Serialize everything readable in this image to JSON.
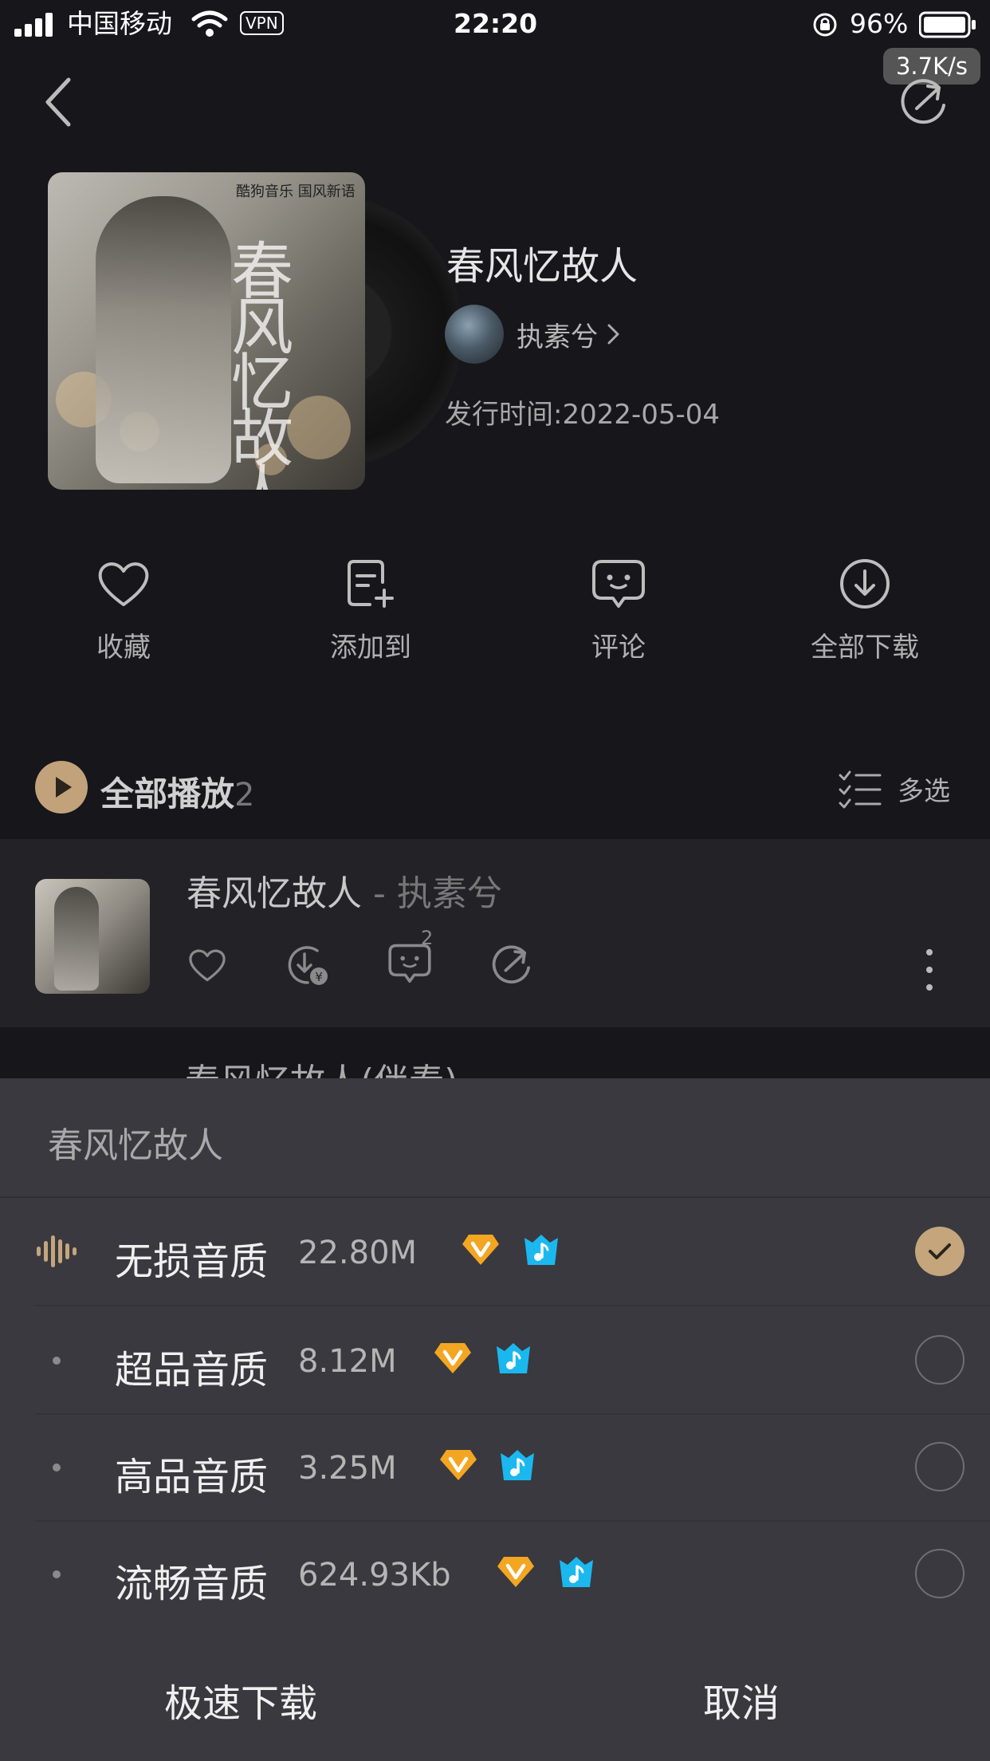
{
  "status_bar": {
    "carrier": "中国移动",
    "vpn": "VPN",
    "time": "22:20",
    "battery": "96%",
    "net_speed": "3.7K/s"
  },
  "icons": {
    "back": "chevron-left-icon",
    "share": "share-icon",
    "play": "play-icon",
    "multi_select": "checklist-icon",
    "lossless": "sound-wave-icon"
  },
  "album": {
    "title": "春风忆故人",
    "artist": "执素兮",
    "artist_chevron": "›",
    "release": "发行时间:2022-05-04",
    "cover_brand": "酷狗音乐 国风新语",
    "cover_calligraphy": "春风忆故人"
  },
  "actions": [
    {
      "label": "收藏",
      "icon": "heart-icon"
    },
    {
      "label": "添加到",
      "icon": "add-to-playlist-icon"
    },
    {
      "label": "评论",
      "icon": "comment-icon"
    },
    {
      "label": "全部下载",
      "icon": "download-icon"
    }
  ],
  "list_header": {
    "play_all": "全部播放",
    "count": "2",
    "multi_select": "多选"
  },
  "songs": [
    {
      "title": "春风忆故人",
      "separator": " - ",
      "artist": "执素兮",
      "comment_count": "2"
    }
  ],
  "next_song_peek": "春风忆故人(伴奏)",
  "sheet": {
    "title": "春风忆故人",
    "options": [
      {
        "name": "无损音质",
        "size": "22.80M",
        "selected": true
      },
      {
        "name": "超品音质",
        "size": "8.12M",
        "selected": false
      },
      {
        "name": "高品音质",
        "size": "3.25M",
        "selected": false
      },
      {
        "name": "流畅音质",
        "size": "624.93Kb",
        "selected": false
      }
    ],
    "fast_download": "极速下载",
    "cancel": "取消"
  },
  "colors": {
    "background": "#16161b",
    "sheet": "#39393f",
    "accent_gold": "#c4a57c",
    "vip_orange": "#f3a621",
    "vip_blue": "#1bb8f0"
  }
}
